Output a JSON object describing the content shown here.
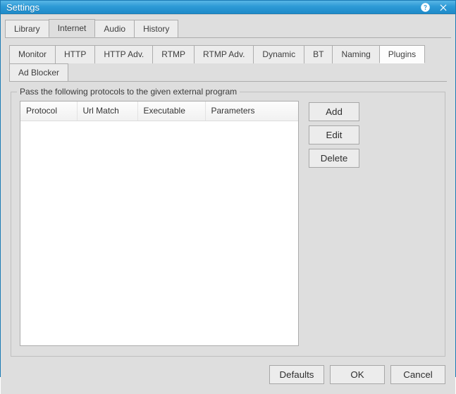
{
  "title": "Settings",
  "top_tabs": [
    "Library",
    "Internet",
    "Audio",
    "History"
  ],
  "top_tabs_active_index": 1,
  "sub_tabs": [
    "Monitor",
    "HTTP",
    "HTTP Adv.",
    "RTMP",
    "RTMP Adv.",
    "Dynamic",
    "BT",
    "Naming",
    "Plugins",
    "Ad Blocker"
  ],
  "sub_tabs_active_index": 8,
  "group_label": "Pass the following protocols to the given external program",
  "table": {
    "columns": [
      "Protocol",
      "Url Match",
      "Executable",
      "Parameters"
    ],
    "rows": []
  },
  "side_buttons": {
    "add": "Add",
    "edit": "Edit",
    "delete": "Delete"
  },
  "footer": {
    "defaults": "Defaults",
    "ok": "OK",
    "cancel": "Cancel"
  }
}
